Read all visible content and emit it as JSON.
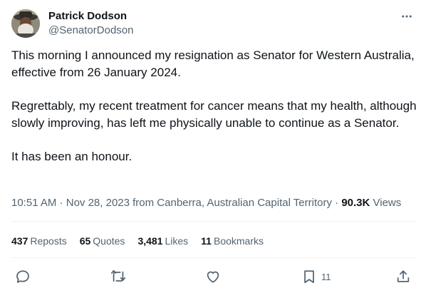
{
  "author": {
    "name": "Patrick Dodson",
    "handle": "@SenatorDodson"
  },
  "tweet": {
    "paragraphs": [
      "This morning I announced my resignation as Senator for Western Australia, effective from 26 January 2024.",
      "Regrettably, my recent treatment for cancer means that my health, although slowly improving, has left me physically unable to continue as a Senator.",
      "It has been an honour."
    ]
  },
  "meta": {
    "time": "10:51 AM",
    "separator1": " · ",
    "date": "Nov 28, 2023",
    "location": " from Canberra, Australian Capital Territory",
    "separator2": " · ",
    "views_count": "90.3K",
    "views_label": " Views"
  },
  "stats": {
    "reposts_count": "437",
    "reposts_label": "Reposts",
    "quotes_count": "65",
    "quotes_label": "Quotes",
    "likes_count": "3,481",
    "likes_label": "Likes",
    "bookmarks_count": "11",
    "bookmarks_label": "Bookmarks"
  },
  "actions": {
    "bookmark_count": "11"
  },
  "icons": {
    "more": "more-horizontal-icon",
    "reply": "reply-icon",
    "repost": "repost-icon",
    "like": "heart-icon",
    "bookmark": "bookmark-icon",
    "share": "share-icon"
  },
  "colors": {
    "text_primary": "#0f1419",
    "text_secondary": "#536471",
    "divider": "#eff3f4"
  }
}
